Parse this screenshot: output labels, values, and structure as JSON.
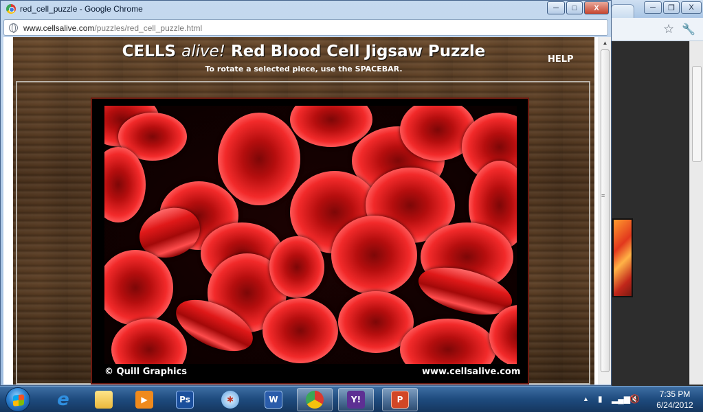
{
  "window": {
    "title": "red_cell_puzzle - Google Chrome",
    "minimize_glyph": "─",
    "maximize_glyph": "□",
    "close_glyph": "X"
  },
  "address": {
    "domain": "www.cellsalive.com",
    "path": "/puzzles/red_cell_puzzle.html"
  },
  "page": {
    "title_prefix": "CELLS",
    "title_italic": "alive!",
    "title_suffix": "Red Blood Cell Jigsaw Puzzle",
    "subtitle": "To rotate a selected piece, use the SPACEBAR.",
    "help_label": "HELP",
    "photo_credit": "© Quill Graphics",
    "photo_site": "www.cellsalive.com"
  },
  "background_window": {
    "minimize_glyph": "─",
    "restore_glyph": "❐",
    "close_glyph": "X"
  },
  "taskbar": {
    "apps": [
      {
        "name": "internet-explorer",
        "glyph": "e"
      },
      {
        "name": "file-explorer",
        "glyph": ""
      },
      {
        "name": "media-player",
        "glyph": "▶"
      },
      {
        "name": "photoshop",
        "glyph": "Ps"
      },
      {
        "name": "safari",
        "glyph": "✱"
      },
      {
        "name": "word",
        "glyph": "W"
      },
      {
        "name": "chrome",
        "glyph": ""
      },
      {
        "name": "yahoo-messenger",
        "glyph": "Y!"
      },
      {
        "name": "powerpoint",
        "glyph": "P"
      }
    ],
    "clock_time": "7:35 PM",
    "clock_date": "6/24/2012"
  },
  "colors": {
    "board_wood": "#5b3e24",
    "cell_red": "#e01919",
    "taskbar_blue": "#1e4b7e"
  }
}
